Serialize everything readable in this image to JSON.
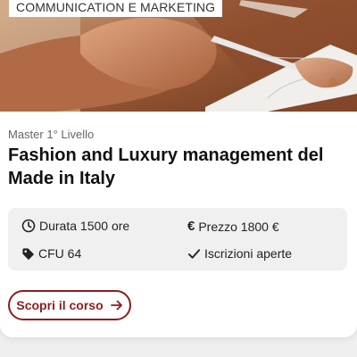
{
  "card": {
    "category_tag": "COMMUNICATION E MARKETING",
    "level": "Master 1° Livello",
    "title": "Fashion and Luxury management del Made in Italy",
    "details": {
      "duration": "Durata 1500 ore",
      "price": "Prezzo 1800 €",
      "credits": "CFU 64",
      "status": "Iscrizioni aperte"
    },
    "cta_label": "Scopri il corso"
  },
  "colors": {
    "accent": "#8b1d1d",
    "info_bg": "#f0f0f0",
    "text_dark": "#111111",
    "text_muted": "#666666"
  },
  "icons": {
    "duration": "clock-icon",
    "price": "euro-icon",
    "credits": "tag-icon",
    "status": "check-icon",
    "cta": "arrow-right-icon"
  }
}
